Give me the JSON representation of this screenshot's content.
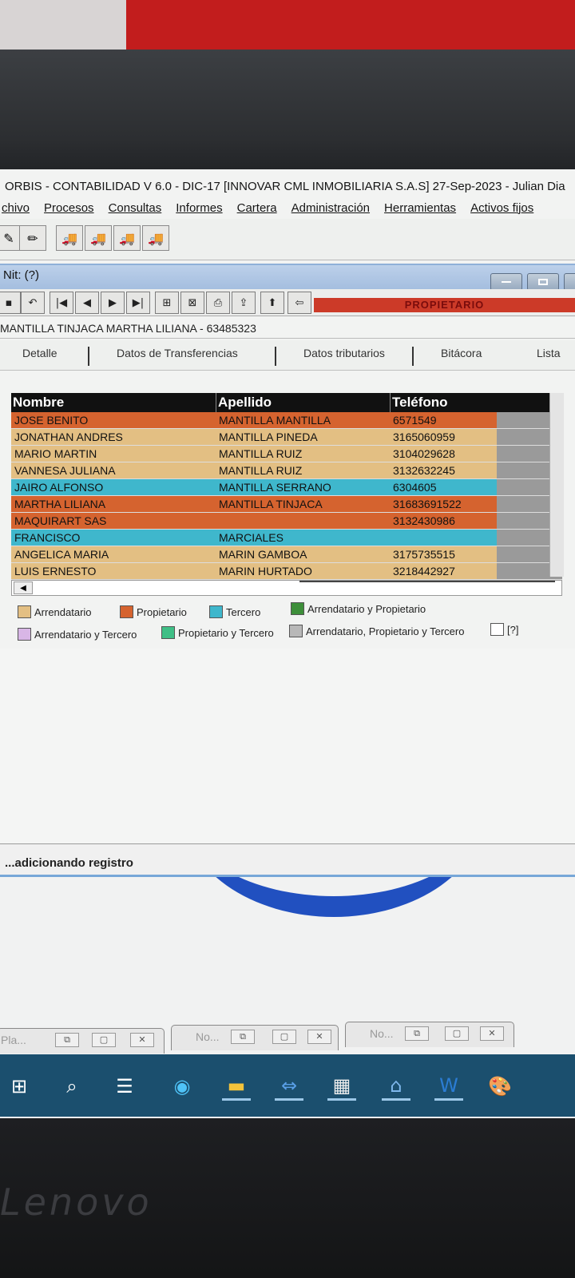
{
  "app": {
    "title": "ORBIS - CONTABILIDAD V 6.0 - DIC-17 [INNOVAR CML INMOBILIARIA S.A.S] 27-Sep-2023 - Julian Dia"
  },
  "menu": [
    "chivo",
    "Procesos",
    "Consultas",
    "Informes",
    "Cartera",
    "Administración",
    "Herramientas",
    "Activos fijos"
  ],
  "subwindow": {
    "title": "Nit: (?)",
    "status_label": "PROPIETARIO",
    "record": "MANTILLA TINJACA MARTHA LILIANA - 63485323"
  },
  "tabs": [
    "Detalle",
    "Datos de Transferencias",
    "Datos tributarios",
    "Bitácora",
    "Lista"
  ],
  "grid": {
    "headers": [
      "Nombre",
      "Apellido",
      "Teléfono"
    ],
    "rows": [
      {
        "nombre": "JOSE BENITO",
        "apellido": "MANTILLA MANTILLA",
        "telefono": "6571549",
        "tipo": "Propietario"
      },
      {
        "nombre": "JONATHAN ANDRES",
        "apellido": "MANTILLA PINEDA",
        "telefono": "3165060959",
        "tipo": "Arrendatario"
      },
      {
        "nombre": "MARIO MARTIN",
        "apellido": "MANTILLA RUIZ",
        "telefono": "3104029628",
        "tipo": "Arrendatario"
      },
      {
        "nombre": "VANNESA JULIANA",
        "apellido": "MANTILLA RUIZ",
        "telefono": "3132632245",
        "tipo": "Arrendatario"
      },
      {
        "nombre": "JAIRO ALFONSO",
        "apellido": "MANTILLA SERRANO",
        "telefono": "6304605",
        "tipo": "Tercero"
      },
      {
        "nombre": "MARTHA LILIANA",
        "apellido": "MANTILLA TINJACA",
        "telefono": "31683691522",
        "tipo": "Propietario"
      },
      {
        "nombre": "MAQUIRART SAS",
        "apellido": "",
        "telefono": "3132430986",
        "tipo": "Propietario"
      },
      {
        "nombre": "FRANCISCO",
        "apellido": "MARCIALES",
        "telefono": "",
        "tipo": "Tercero"
      },
      {
        "nombre": "ANGELICA MARIA",
        "apellido": "MARIN GAMBOA",
        "telefono": "3175735515",
        "tipo": "Arrendatario"
      },
      {
        "nombre": "LUIS ERNESTO",
        "apellido": "MARIN HURTADO",
        "telefono": "3218442927",
        "tipo": "Arrendatario"
      }
    ]
  },
  "legend": [
    {
      "label": "Arrendatario",
      "color": "#e3bf83"
    },
    {
      "label": "Propietario",
      "color": "#d5632f"
    },
    {
      "label": "Tercero",
      "color": "#3fb7cc"
    },
    {
      "label": "Arrendatario y Propietario",
      "color": "#3d8f3a"
    },
    {
      "label": "Arrendatario y Tercero",
      "color": "#d8b6e6"
    },
    {
      "label": "Propietario y Tercero",
      "color": "#3fbf86"
    },
    {
      "label": "Arrendatario, Propietario y Tercero",
      "color": "#b8b8b8"
    },
    {
      "label": "[?]",
      "color": "#ffffff"
    }
  ],
  "colors": {
    "Arrendatario": "#e3bf83",
    "Propietario": "#d5632f",
    "Tercero": "#3fb7cc"
  },
  "statusbar": "...adicionando registro",
  "minimized": [
    "Pla...",
    "No...",
    "No..."
  ],
  "taskbar_icons": [
    "windows-start-icon",
    "search-icon",
    "task-view-icon",
    "edge-browser-icon",
    "file-explorer-icon",
    "remote-access-icon",
    "calculator-icon",
    "home-app-icon",
    "word-icon",
    "paint-icon"
  ],
  "brand": "Lenovo"
}
